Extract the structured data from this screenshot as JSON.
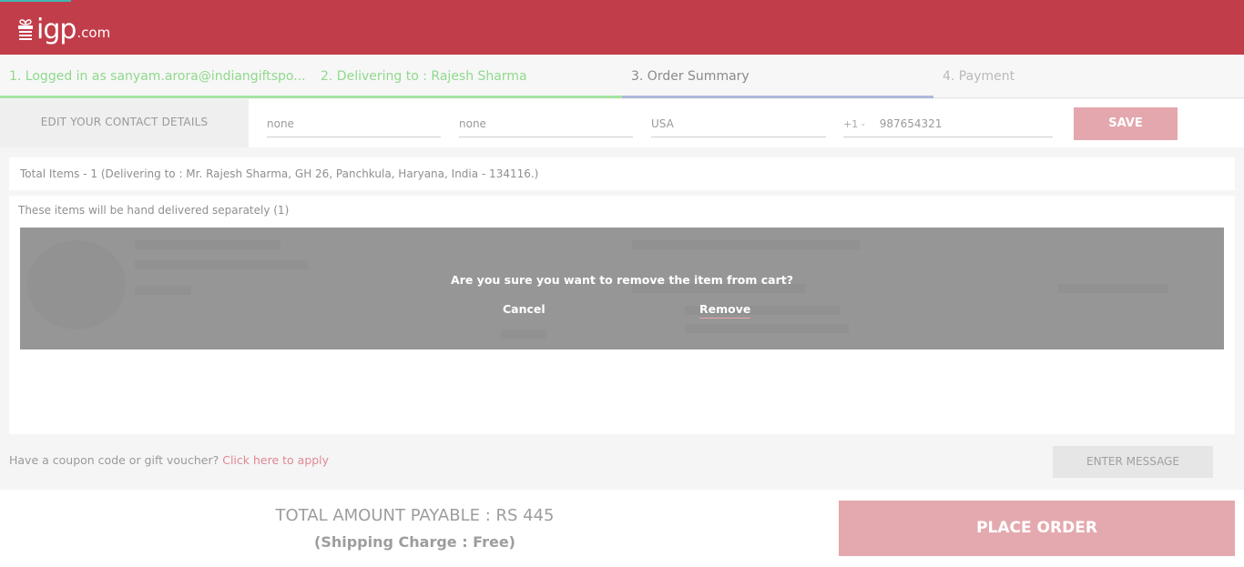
{
  "header": {
    "logo_main": "igp",
    "logo_domain": ".com",
    "colors": {
      "primary": "#c13d4a",
      "accent": "#3fb7b2"
    }
  },
  "steps": [
    {
      "label": "1. Logged in as sanyam.arora@indiangiftspo...",
      "state": "done"
    },
    {
      "label": "2. Delivering to : Rajesh Sharma",
      "state": "done"
    },
    {
      "label": "3. Order Summary",
      "state": "active"
    },
    {
      "label": "4. Payment",
      "state": "pending"
    }
  ],
  "contact": {
    "section_label": "EDIT YOUR CONTACT DETAILS",
    "first_name": "none",
    "last_name": "none",
    "country": "USA",
    "phone_code": "+1 -",
    "phone": "987654321",
    "save_label": "SAVE"
  },
  "summary": {
    "total_items_text": "Total Items - 1 (Delivering to : Mr. Rajesh Sharma, GH 26, Panchkula, Haryana, India - 134116.)",
    "hand_delivered_text": "These items will be hand delivered separately (1)"
  },
  "dialog": {
    "question": "Are you sure you want to remove the item from cart?",
    "cancel_label": "Cancel",
    "remove_label": "Remove"
  },
  "coupon": {
    "prompt": "Have a coupon code or gift voucher?",
    "link_label": "Click here to apply"
  },
  "enter_message_label": "ENTER MESSAGE",
  "footer": {
    "amount_text": "TOTAL AMOUNT PAYABLE : RS 445",
    "shipping_text": "(Shipping Charge : Free)",
    "place_order_label": "PLACE ORDER"
  }
}
